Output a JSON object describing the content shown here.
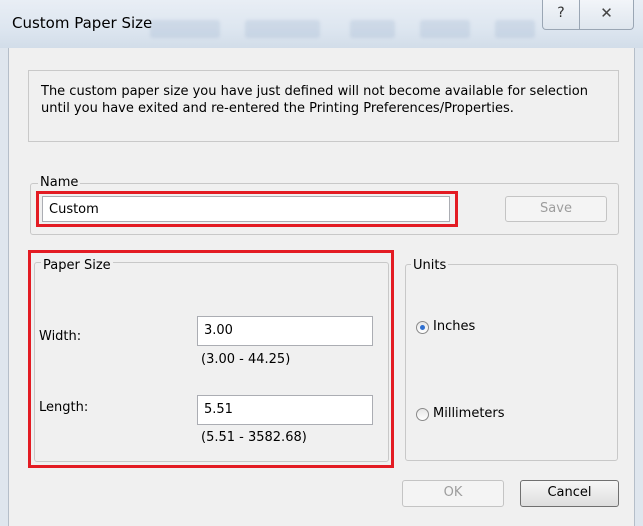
{
  "window": {
    "title": "Custom Paper Size"
  },
  "titlebar": {
    "help_symbol": "?",
    "close_symbol": "✕"
  },
  "info": {
    "message": "The custom paper size you have just defined will not become available for selection until you have exited and re-entered the Printing Preferences/Properties."
  },
  "name_section": {
    "legend": "Name",
    "value": "Custom",
    "save_label": "Save"
  },
  "paper_size": {
    "legend": "Paper Size",
    "width_label": "Width:",
    "width_value": "3.00",
    "width_range": "(3.00 - 44.25)",
    "length_label": "Length:",
    "length_value": "5.51",
    "length_range": "(5.51 - 3582.68)"
  },
  "units": {
    "legend": "Units",
    "options": [
      "Inches",
      "Millimeters"
    ],
    "selected": "Inches"
  },
  "footer": {
    "ok_label": "OK",
    "cancel_label": "Cancel"
  },
  "colors": {
    "highlight": "#e31b23",
    "radio_dot": "#2f6fd0"
  }
}
